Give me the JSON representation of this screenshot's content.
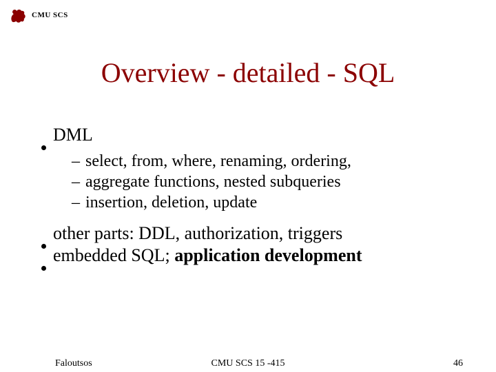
{
  "header": {
    "label": "CMU SCS"
  },
  "title": "Overview - detailed - SQL",
  "bullets": {
    "b0": "DML",
    "b0_sub0": "select, from, where, renaming, ordering,",
    "b0_sub1": " aggregate functions, nested subqueries",
    "b0_sub2": "insertion, deletion, update",
    "b1": "other parts: DDL, authorization, triggers",
    "b2_prefix": "embedded SQL; ",
    "b2_bold": "application development"
  },
  "footer": {
    "left": "Faloutsos",
    "center": "CMU SCS 15 -415",
    "right": "46"
  }
}
